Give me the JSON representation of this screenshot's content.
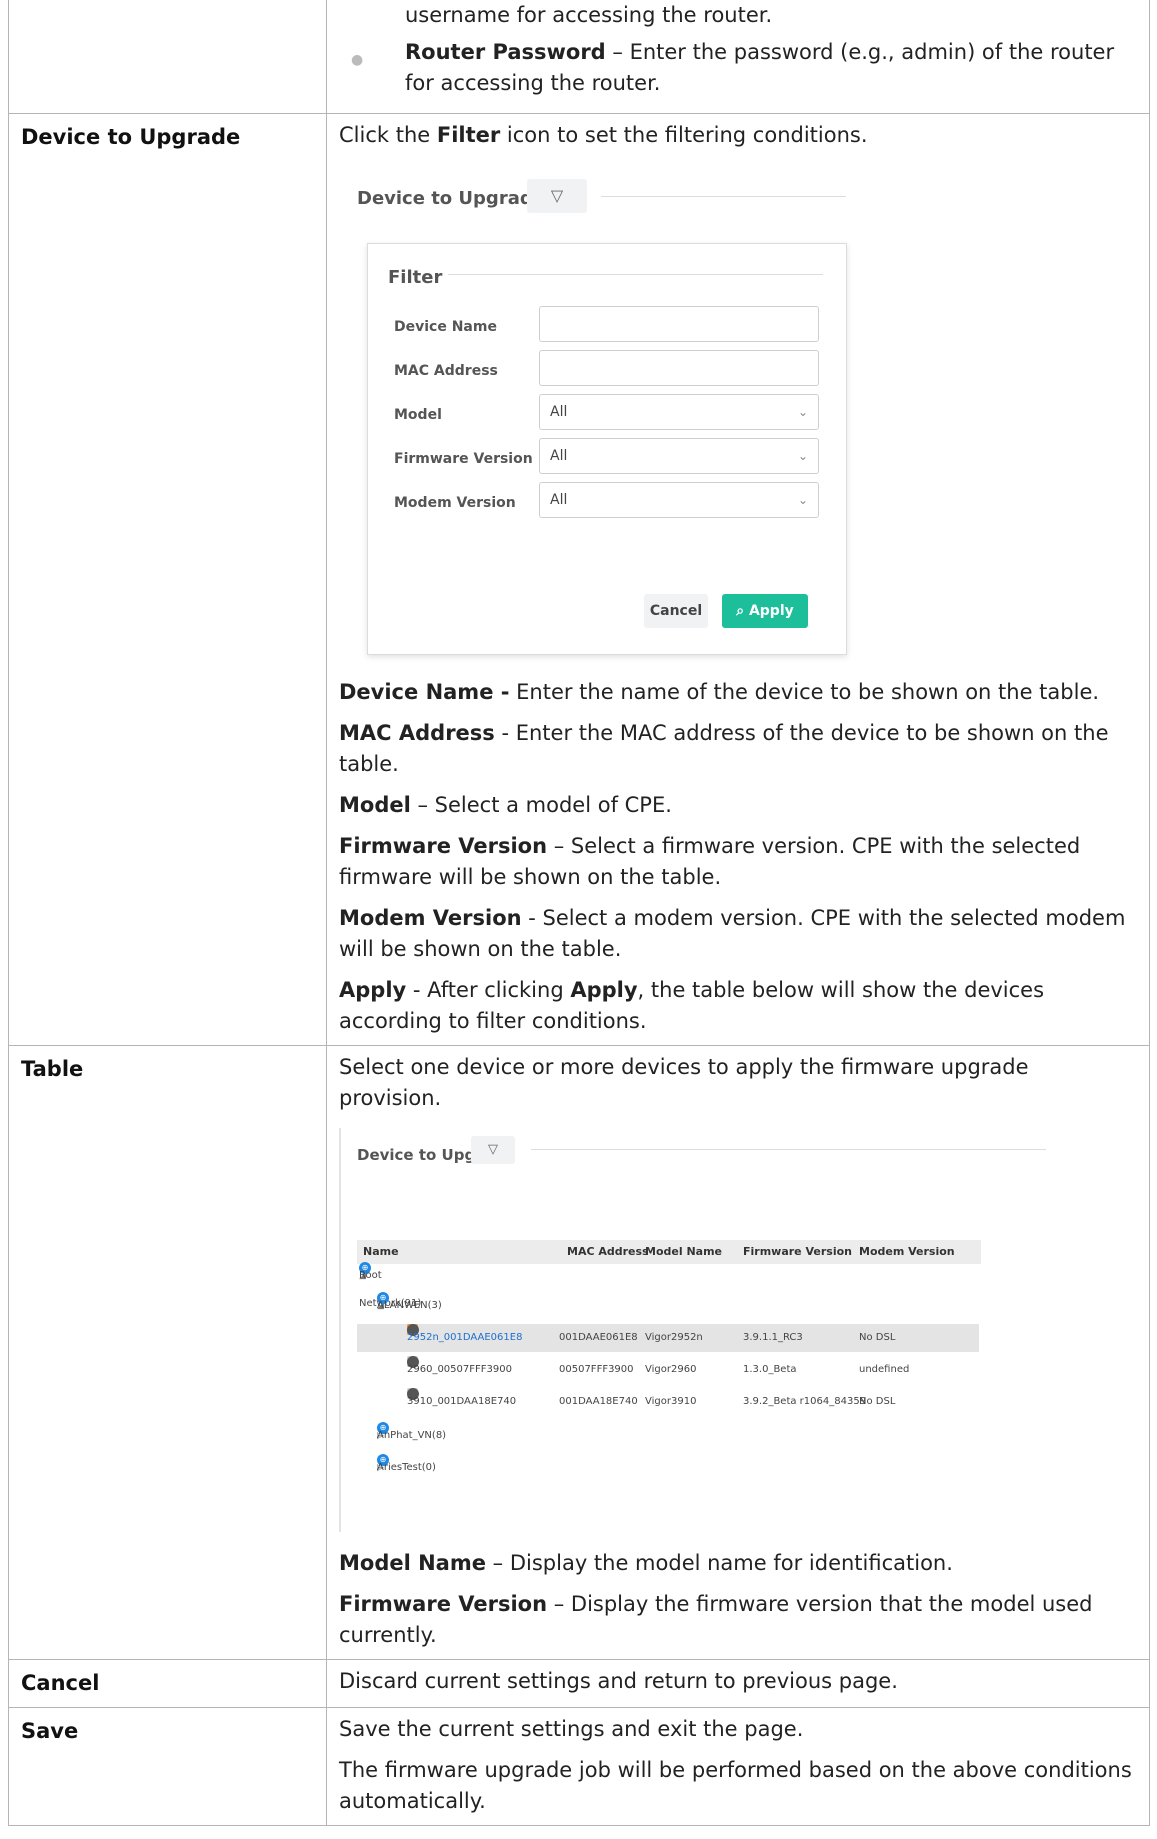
{
  "top_row": {
    "continued_text": "username for accessing the router.",
    "password_bold": "Router Password",
    "password_text": " – Enter the password (e.g., admin) of the router for accessing the router."
  },
  "device_row": {
    "label": "Device to Upgrade",
    "intro_pre": "Click the ",
    "intro_bold": "Filter",
    "intro_post": " icon to set the filtering conditions.",
    "screenshot": {
      "title": "Device to Upgrade",
      "filter_title": "Filter",
      "fields": [
        {
          "label": "Device Name",
          "value": ""
        },
        {
          "label": "MAC Address",
          "value": ""
        },
        {
          "label": "Model",
          "value": "All"
        },
        {
          "label": "Firmware Version",
          "value": "All"
        },
        {
          "label": "Modem Version",
          "value": "All"
        }
      ],
      "cancel": "Cancel",
      "apply": "Apply"
    },
    "items": [
      {
        "bold": "Device Name -",
        "text": " Enter the name of the device to be shown on the table."
      },
      {
        "bold": "MAC Address",
        "text": " - Enter the MAC address of the device to be shown on the table."
      },
      {
        "bold": "Model",
        "text": " – Select a model of CPE."
      },
      {
        "bold": "Firmware Version",
        "text": " – Select a firmware version. CPE with the selected firmware will be shown on the table."
      },
      {
        "bold": "Modem Version",
        "text": " - Select a modem version. CPE with the selected modem will be shown on the table."
      }
    ],
    "apply_item": {
      "bold": "Apply",
      "pre": " - After clicking ",
      "bold2": "Apply",
      "post": ", the table below will show the devices according to filter conditions."
    }
  },
  "table_row": {
    "label": "Table",
    "intro": "Select one device or more devices to apply the firmware upgrade provision.",
    "screenshot": {
      "title": "Device to Upgrade",
      "headers": [
        "Name",
        "MAC Address",
        "Model Name",
        "Firmware Version",
        "Modem Version"
      ],
      "tree": [
        {
          "name": "Root Network(91)"
        },
        {
          "name": "ALANWEN(3)"
        },
        {
          "name": "2952n_001DAAE061E8",
          "mac": "001DAAE061E8",
          "model": "Vigor2952n",
          "fw": "3.9.1.1_RC3",
          "modem": "No DSL"
        },
        {
          "name": "2960_00507FFF3900",
          "mac": "00507FFF3900",
          "model": "Vigor2960",
          "fw": "1.3.0_Beta",
          "modem": "undefined"
        },
        {
          "name": "3910_001DAA18E740",
          "mac": "001DAA18E740",
          "model": "Vigor3910",
          "fw": "3.9.2_Beta r1064_84359",
          "modem": "No DSL"
        },
        {
          "name": "AnPhat_VN(8)"
        },
        {
          "name": "AriesTest(0)"
        }
      ]
    },
    "items": [
      {
        "bold": "Model Name",
        "text": " – Display the model name for identification."
      },
      {
        "bold": "Firmware Version",
        "text": " – Display the firmware version that the model used currently."
      }
    ]
  },
  "cancel_row": {
    "label": "Cancel",
    "text": "Discard current settings and return to previous page."
  },
  "save_row": {
    "label": "Save",
    "text1": "Save the current settings and exit the page.",
    "text2": "The firmware upgrade job will be performed based on the above conditions automatically."
  }
}
